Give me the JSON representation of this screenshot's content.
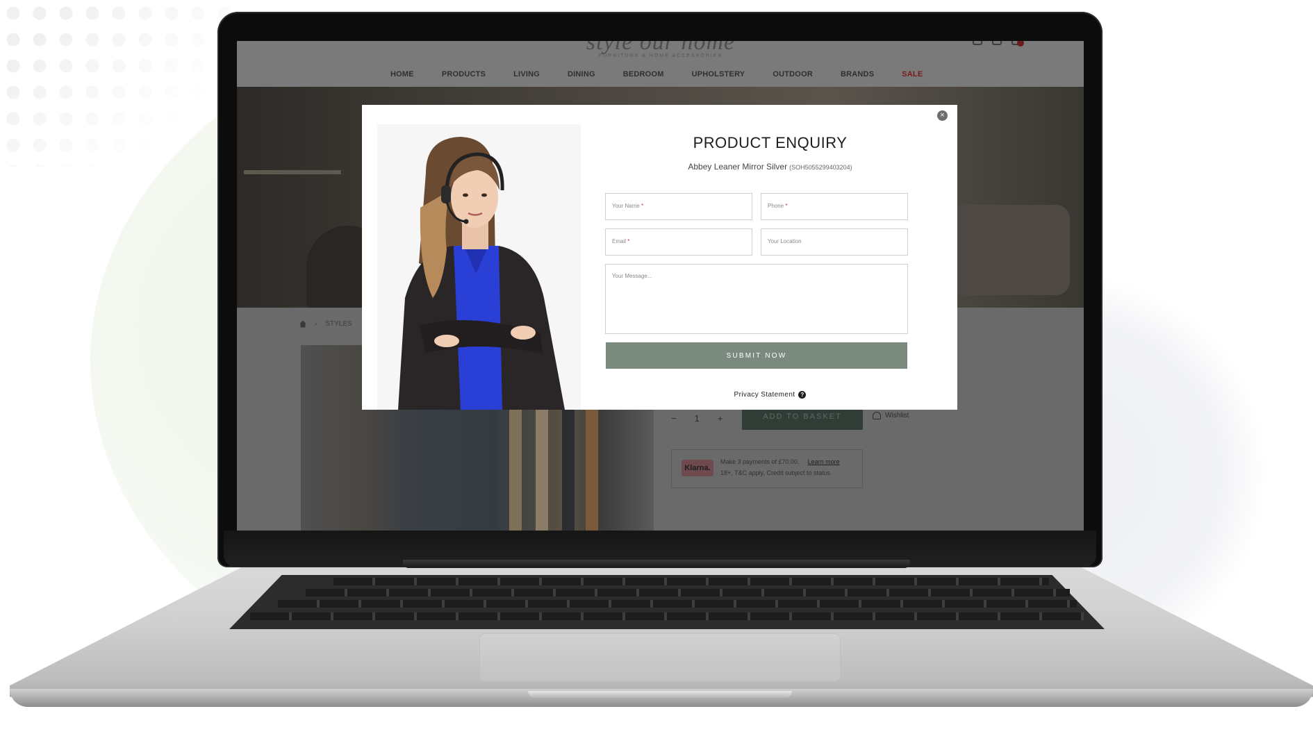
{
  "site": {
    "logo_text": "style our home",
    "logo_tagline": "FURNITURE & HOME ACCESSORIES",
    "nav": [
      "HOME",
      "PRODUCTS",
      "LIVING",
      "DINING",
      "BEDROOM",
      "UPHOLSTERY",
      "OUTDOOR",
      "BRANDS",
      "SALE"
    ],
    "breadcrumb": {
      "section": "STYLES"
    }
  },
  "product": {
    "quantity": "1",
    "minus": "−",
    "plus": "+",
    "add_to_basket": "ADD TO BASKET",
    "wishlist": "Wishlist"
  },
  "klarna": {
    "logo": "Klarna.",
    "line1": "Make 3 payments of £70.00.",
    "learn_more": "Learn more",
    "line2": "18+, T&C apply, Credit subject to status."
  },
  "modal": {
    "close_glyph": "×",
    "title": "PRODUCT ENQUIRY",
    "product_name": "Abbey Leaner Mirror Silver",
    "product_sku": "(SOH5055299403204)",
    "fields": {
      "name_placeholder": "Your Name",
      "phone_placeholder": "Phone",
      "email_placeholder": "Email",
      "location_placeholder": "Your Location",
      "message_placeholder": "Your Message..."
    },
    "required_mark": "*",
    "submit_label": "SUBMIT NOW",
    "privacy_label": "Privacy Statement",
    "privacy_icon_glyph": "?"
  },
  "colors": {
    "submit_bg": "#7b8a7e",
    "sale_nav": "#c0392b",
    "overlay_dim": "#6b6b6b"
  }
}
